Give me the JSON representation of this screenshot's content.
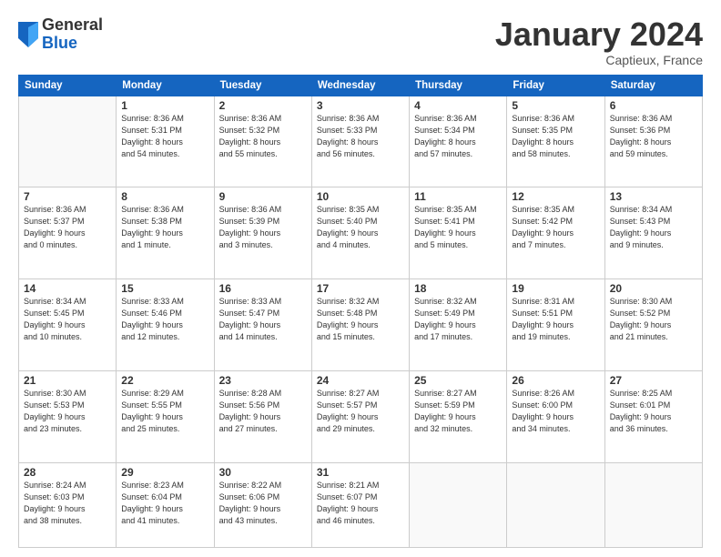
{
  "logo": {
    "general": "General",
    "blue": "Blue"
  },
  "title": "January 2024",
  "location": "Captieux, France",
  "days_header": [
    "Sunday",
    "Monday",
    "Tuesday",
    "Wednesday",
    "Thursday",
    "Friday",
    "Saturday"
  ],
  "weeks": [
    [
      {
        "day": "",
        "info": ""
      },
      {
        "day": "1",
        "info": "Sunrise: 8:36 AM\nSunset: 5:31 PM\nDaylight: 8 hours\nand 54 minutes."
      },
      {
        "day": "2",
        "info": "Sunrise: 8:36 AM\nSunset: 5:32 PM\nDaylight: 8 hours\nand 55 minutes."
      },
      {
        "day": "3",
        "info": "Sunrise: 8:36 AM\nSunset: 5:33 PM\nDaylight: 8 hours\nand 56 minutes."
      },
      {
        "day": "4",
        "info": "Sunrise: 8:36 AM\nSunset: 5:34 PM\nDaylight: 8 hours\nand 57 minutes."
      },
      {
        "day": "5",
        "info": "Sunrise: 8:36 AM\nSunset: 5:35 PM\nDaylight: 8 hours\nand 58 minutes."
      },
      {
        "day": "6",
        "info": "Sunrise: 8:36 AM\nSunset: 5:36 PM\nDaylight: 8 hours\nand 59 minutes."
      }
    ],
    [
      {
        "day": "7",
        "info": "Sunrise: 8:36 AM\nSunset: 5:37 PM\nDaylight: 9 hours\nand 0 minutes."
      },
      {
        "day": "8",
        "info": "Sunrise: 8:36 AM\nSunset: 5:38 PM\nDaylight: 9 hours\nand 1 minute."
      },
      {
        "day": "9",
        "info": "Sunrise: 8:36 AM\nSunset: 5:39 PM\nDaylight: 9 hours\nand 3 minutes."
      },
      {
        "day": "10",
        "info": "Sunrise: 8:35 AM\nSunset: 5:40 PM\nDaylight: 9 hours\nand 4 minutes."
      },
      {
        "day": "11",
        "info": "Sunrise: 8:35 AM\nSunset: 5:41 PM\nDaylight: 9 hours\nand 5 minutes."
      },
      {
        "day": "12",
        "info": "Sunrise: 8:35 AM\nSunset: 5:42 PM\nDaylight: 9 hours\nand 7 minutes."
      },
      {
        "day": "13",
        "info": "Sunrise: 8:34 AM\nSunset: 5:43 PM\nDaylight: 9 hours\nand 9 minutes."
      }
    ],
    [
      {
        "day": "14",
        "info": "Sunrise: 8:34 AM\nSunset: 5:45 PM\nDaylight: 9 hours\nand 10 minutes."
      },
      {
        "day": "15",
        "info": "Sunrise: 8:33 AM\nSunset: 5:46 PM\nDaylight: 9 hours\nand 12 minutes."
      },
      {
        "day": "16",
        "info": "Sunrise: 8:33 AM\nSunset: 5:47 PM\nDaylight: 9 hours\nand 14 minutes."
      },
      {
        "day": "17",
        "info": "Sunrise: 8:32 AM\nSunset: 5:48 PM\nDaylight: 9 hours\nand 15 minutes."
      },
      {
        "day": "18",
        "info": "Sunrise: 8:32 AM\nSunset: 5:49 PM\nDaylight: 9 hours\nand 17 minutes."
      },
      {
        "day": "19",
        "info": "Sunrise: 8:31 AM\nSunset: 5:51 PM\nDaylight: 9 hours\nand 19 minutes."
      },
      {
        "day": "20",
        "info": "Sunrise: 8:30 AM\nSunset: 5:52 PM\nDaylight: 9 hours\nand 21 minutes."
      }
    ],
    [
      {
        "day": "21",
        "info": "Sunrise: 8:30 AM\nSunset: 5:53 PM\nDaylight: 9 hours\nand 23 minutes."
      },
      {
        "day": "22",
        "info": "Sunrise: 8:29 AM\nSunset: 5:55 PM\nDaylight: 9 hours\nand 25 minutes."
      },
      {
        "day": "23",
        "info": "Sunrise: 8:28 AM\nSunset: 5:56 PM\nDaylight: 9 hours\nand 27 minutes."
      },
      {
        "day": "24",
        "info": "Sunrise: 8:27 AM\nSunset: 5:57 PM\nDaylight: 9 hours\nand 29 minutes."
      },
      {
        "day": "25",
        "info": "Sunrise: 8:27 AM\nSunset: 5:59 PM\nDaylight: 9 hours\nand 32 minutes."
      },
      {
        "day": "26",
        "info": "Sunrise: 8:26 AM\nSunset: 6:00 PM\nDaylight: 9 hours\nand 34 minutes."
      },
      {
        "day": "27",
        "info": "Sunrise: 8:25 AM\nSunset: 6:01 PM\nDaylight: 9 hours\nand 36 minutes."
      }
    ],
    [
      {
        "day": "28",
        "info": "Sunrise: 8:24 AM\nSunset: 6:03 PM\nDaylight: 9 hours\nand 38 minutes."
      },
      {
        "day": "29",
        "info": "Sunrise: 8:23 AM\nSunset: 6:04 PM\nDaylight: 9 hours\nand 41 minutes."
      },
      {
        "day": "30",
        "info": "Sunrise: 8:22 AM\nSunset: 6:06 PM\nDaylight: 9 hours\nand 43 minutes."
      },
      {
        "day": "31",
        "info": "Sunrise: 8:21 AM\nSunset: 6:07 PM\nDaylight: 9 hours\nand 46 minutes."
      },
      {
        "day": "",
        "info": ""
      },
      {
        "day": "",
        "info": ""
      },
      {
        "day": "",
        "info": ""
      }
    ]
  ]
}
